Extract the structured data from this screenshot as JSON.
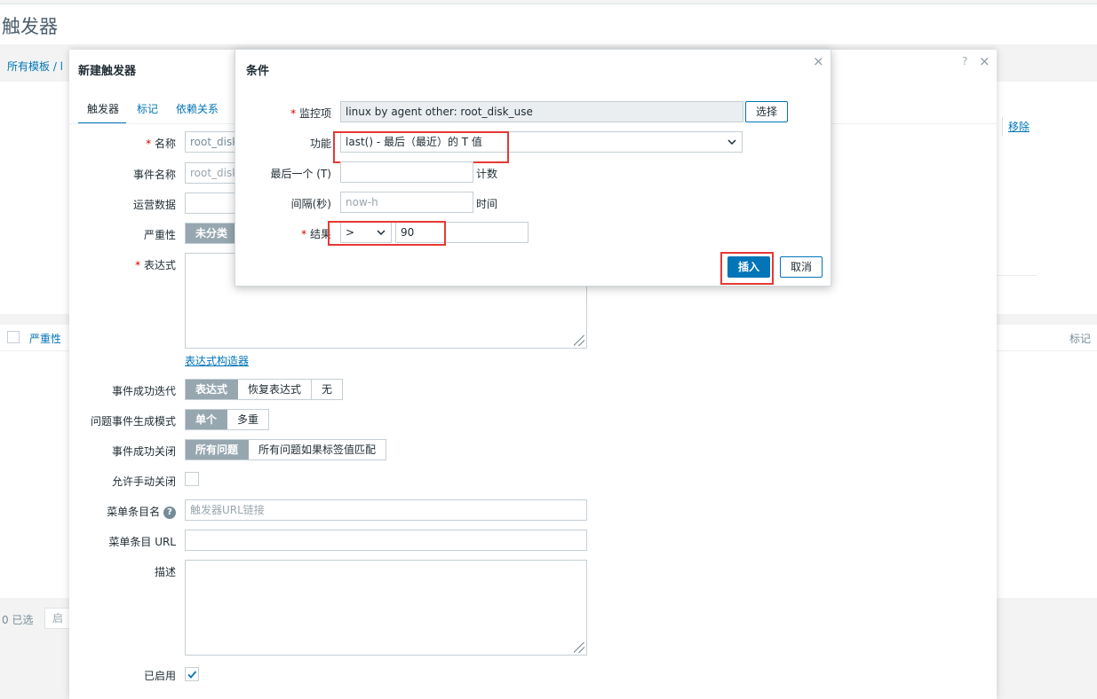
{
  "page": {
    "title": "触发器",
    "breadcrumb": "所有模板 / l",
    "remove_link": "移除",
    "table_header_severity": "严重性",
    "table_header_tags": "标记",
    "selected_count": "0 已选",
    "bg_button_partial": "启"
  },
  "dialog": {
    "title": "新建触发器",
    "help_icon": "?",
    "close_icon": "×",
    "tabs": [
      {
        "label": "触发器"
      },
      {
        "label": "标记"
      },
      {
        "label": "依赖关系"
      }
    ],
    "fields": {
      "name_label": "名称",
      "name_value": "root_disk_",
      "event_name_label": "事件名称",
      "event_name_value": "root_disk_",
      "opdata_label": "运营数据",
      "severity_label": "严重性",
      "severity_selected": "未分类",
      "expression_label": "表达式",
      "expression_builder_link": "表达式构造器",
      "ok_event_label": "事件成功迭代",
      "ok_event_options": [
        "表达式",
        "恢复表达式",
        "无"
      ],
      "problem_mode_label": "问题事件生成模式",
      "problem_mode_options": [
        "单个",
        "多重"
      ],
      "ok_close_label": "事件成功关闭",
      "ok_close_options": [
        "所有问题",
        "所有问题如果标签值匹配"
      ],
      "manual_close_label": "允许手动关闭",
      "menu_name_label": "菜单条目名",
      "menu_name_placeholder": "触发器URL链接",
      "menu_url_label": "菜单条目 URL",
      "description_label": "描述",
      "enabled_label": "已启用"
    }
  },
  "condition_modal": {
    "title": "条件",
    "close_icon": "×",
    "item_label": "监控项",
    "item_value": "linux by agent other: root_disk_use",
    "select_button": "选择",
    "function_label": "功能",
    "function_value": "last() - 最后（最近）的 T 值",
    "last_t_label": "最后一个 (T)",
    "last_t_suffix": "计数",
    "interval_label": "间隔(秒)",
    "interval_placeholder": "now-h",
    "interval_suffix": "时间",
    "result_label": "结果",
    "result_operator": ">",
    "result_value": "90",
    "insert_button": "插入",
    "cancel_button": "取消"
  },
  "colors": {
    "accent": "#0275b8",
    "highlight": "#e53935",
    "segment_selected": "#97a7b0"
  }
}
